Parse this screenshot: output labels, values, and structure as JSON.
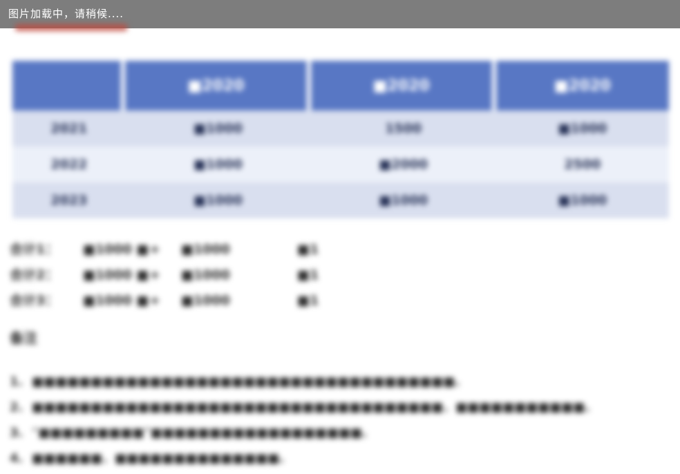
{
  "loading_text": "图片加载中，请稍候....",
  "table": {
    "headers": [
      "",
      "■2020",
      "■2020",
      "■2020"
    ],
    "rows": [
      [
        "2021",
        "■1000",
        "1500",
        "■1000"
      ],
      [
        "2022",
        "■1000",
        "■2000",
        "2500"
      ],
      [
        "2023",
        "■1000",
        "■1000",
        "■1000"
      ]
    ]
  },
  "summary": [
    {
      "label": "合计1：",
      "a": "■1000 ■",
      "x": "+",
      "b": "■1000",
      "c": "■1"
    },
    {
      "label": "合计2：",
      "a": "■1000 ■",
      "x": "+",
      "b": "■1000",
      "c": "■1"
    },
    {
      "label": "合计3：",
      "a": "■1000 ■",
      "x": "+",
      "b": "■1000",
      "c": "■1"
    }
  ],
  "notes_title": "备注",
  "notes": [
    {
      "num": "1.",
      "text": "■■■■■■■■■■■■■■■■■■■■■■■■■■■■■■■■■■■■。"
    },
    {
      "num": "2.",
      "text": "■■■■■■■■■■■■■■■■■■■■■■■■■■■■■■■■■■■，■■■■■■■■■■■。"
    },
    {
      "num": "3.",
      "text": "“■■■■■■■■■”■■■■■■■■■■■■■■■■■■。"
    },
    {
      "num": "4.",
      "text": "■■■■■■，■■■■■■■■■■■■■■。"
    }
  ]
}
